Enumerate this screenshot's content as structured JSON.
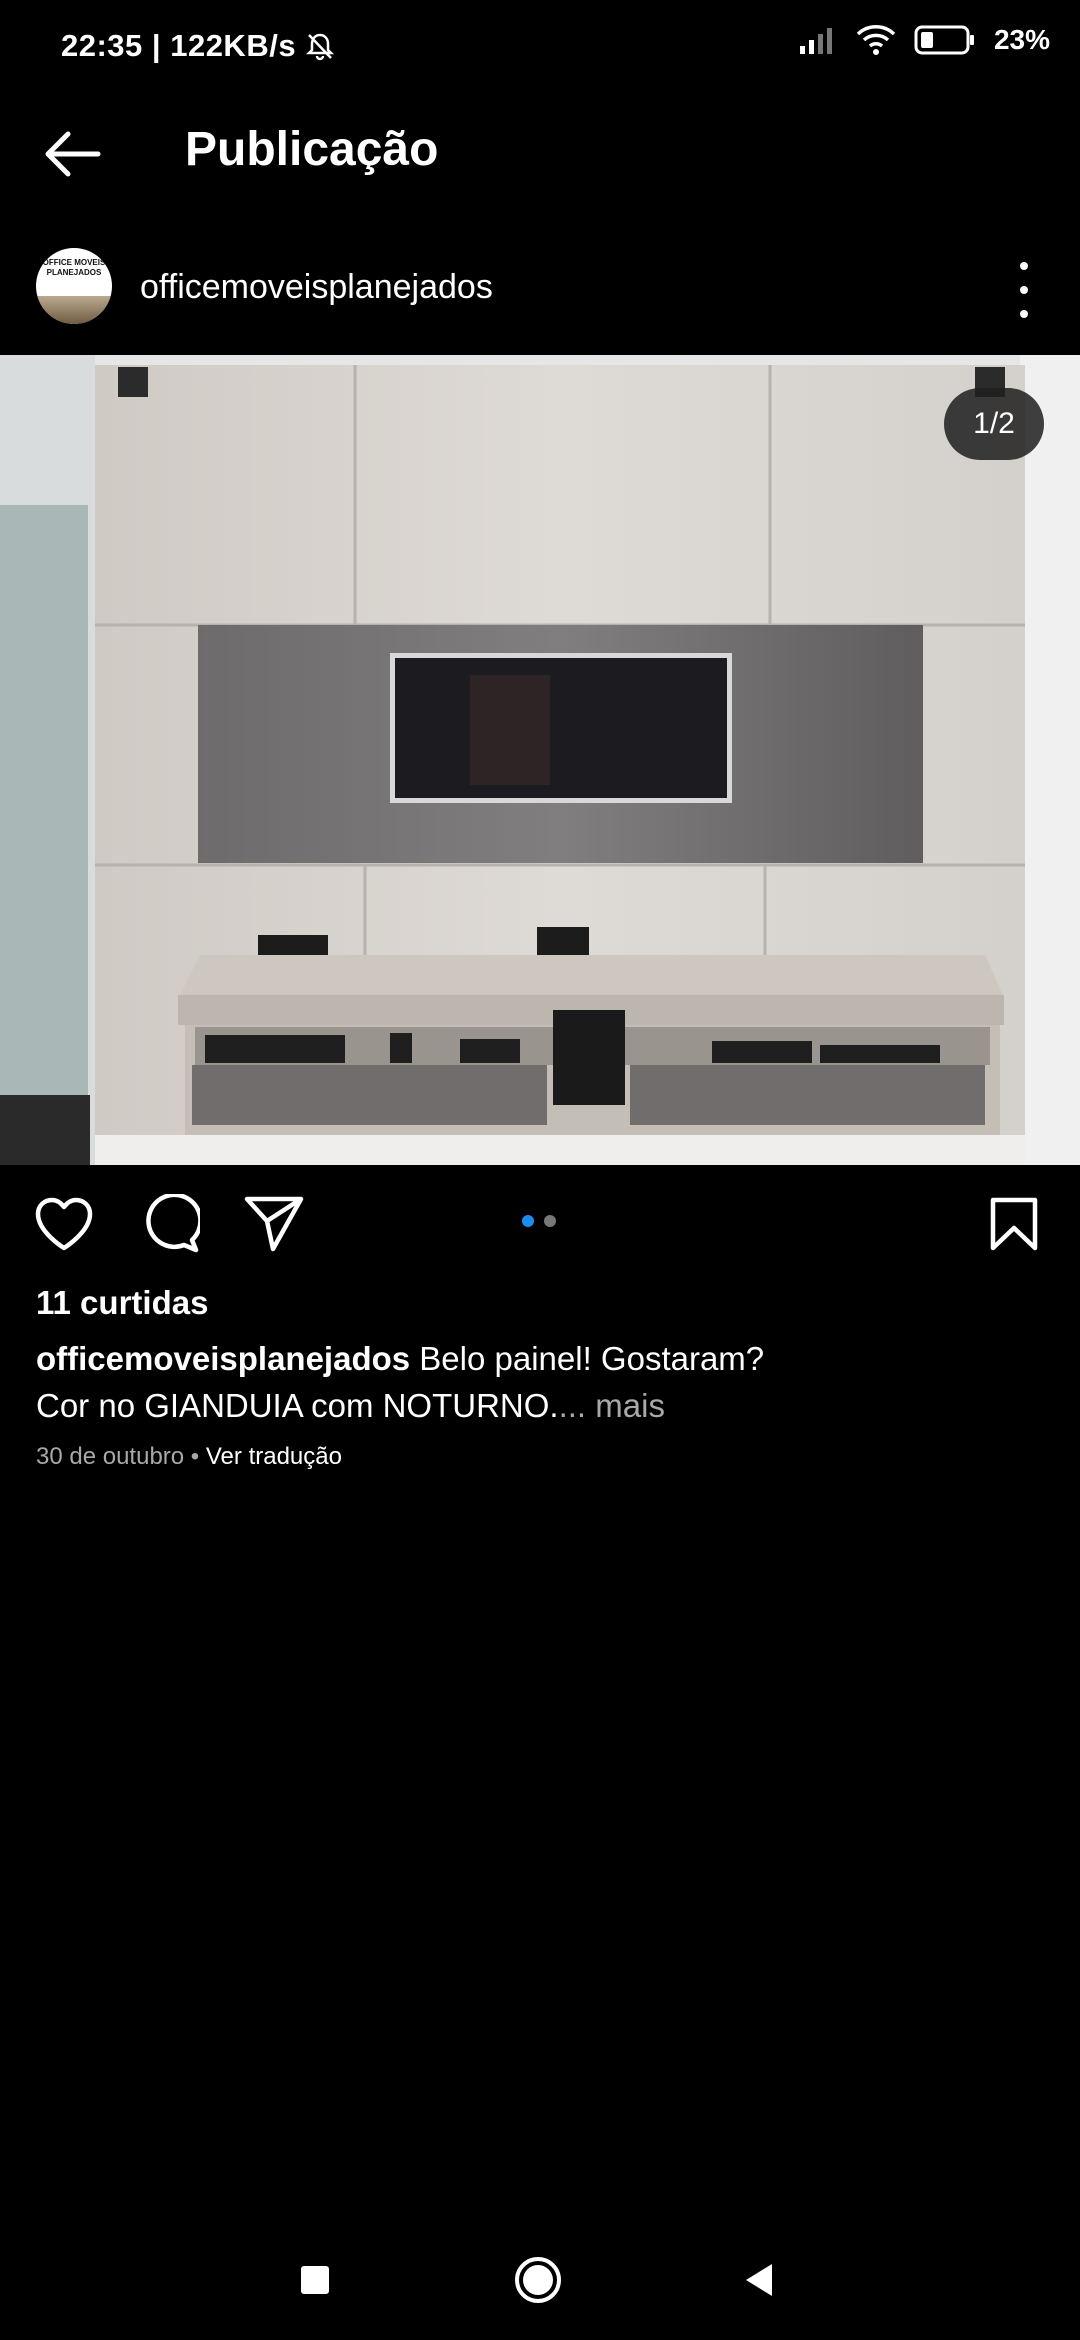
{
  "status_bar": {
    "time": "22:35",
    "network_speed": "| 122KB/s",
    "battery": "23%",
    "icons": [
      "mute-icon",
      "signal-icon",
      "wifi-icon",
      "battery-icon"
    ]
  },
  "header": {
    "title": "Publicação",
    "back_icon": "arrow-left-icon"
  },
  "post": {
    "avatar_text": "OFFICE MOVEIS PLANEJADOS",
    "username": "officemoveisplanejados",
    "page_indicator": "1/2",
    "carousel_dots": 2,
    "carousel_active": 0,
    "likes": "11 curtidas",
    "caption_user": "officemoveisplanejados",
    "caption_line1": "Belo painel! Gostaram?",
    "caption_line2": "Cor no GIANDUIA com NOTURNO.",
    "caption_more": "... mais",
    "date": "30 de outubro",
    "separator": " • ",
    "translate": "Ver tradução"
  },
  "colors": {
    "background": "#000000",
    "accent_dot": "#1d8bf1",
    "secondary_text": "#a8a8a8"
  }
}
